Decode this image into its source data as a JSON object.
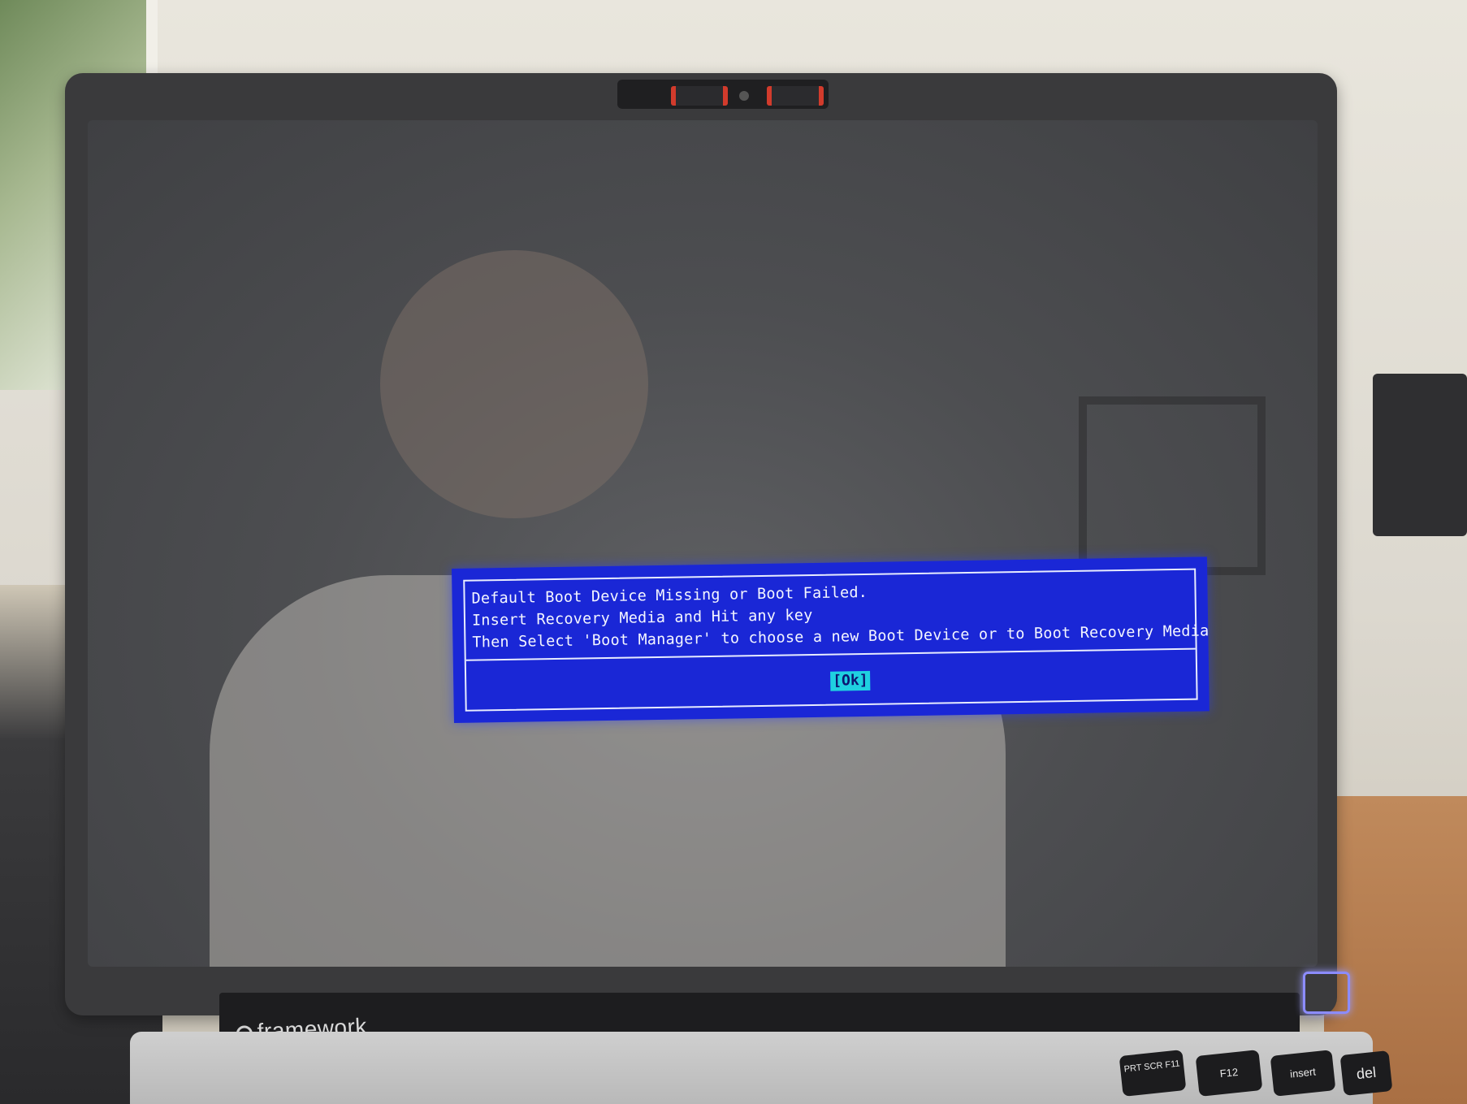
{
  "bios": {
    "line1": "Default Boot Device Missing or Boot Failed.",
    "line2": "Insert Recovery Media and Hit any key",
    "line3": "Then Select 'Boot Manager' to choose a new Boot Device or to Boot Recovery Media",
    "ok_label": "[Ok]",
    "colors": {
      "background": "#1a27d6",
      "text": "#f4f6ff",
      "button_bg": "#1fd0e0"
    }
  },
  "laptop": {
    "brand": "framework"
  },
  "keys": {
    "prt_scr": "PRT SCR F11",
    "f12": "F12",
    "insert": "insert",
    "del": "del"
  }
}
